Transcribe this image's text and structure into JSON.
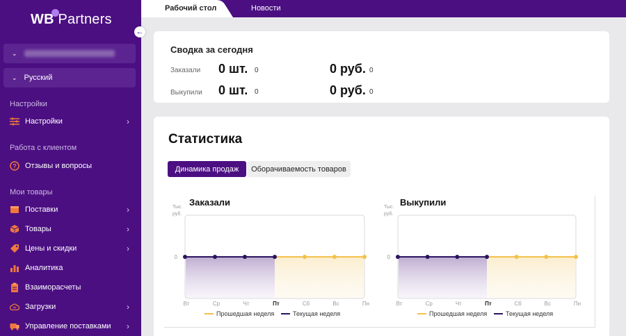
{
  "sidebar": {
    "logo": {
      "brand": "WB",
      "product": "Partners"
    },
    "language": "Русский",
    "sections": [
      "Настройки",
      "Работа с клиентом",
      "Мои товары"
    ],
    "items": [
      {
        "label": "Настройки",
        "icon": "sliders-icon"
      },
      {
        "label": "Отзывы и вопросы",
        "icon": "question-circle-icon"
      },
      {
        "label": "Поставки",
        "icon": "box-icon"
      },
      {
        "label": "Товары",
        "icon": "cube-icon"
      },
      {
        "label": "Цены и скидки",
        "icon": "tag-icon"
      },
      {
        "label": "Аналитика",
        "icon": "bar-chart-icon"
      },
      {
        "label": "Взаиморасчеты",
        "icon": "clipboard-icon"
      },
      {
        "label": "Загрузки",
        "icon": "cloud-upload-icon"
      },
      {
        "label": "Управление поставками",
        "icon": "truck-icon"
      }
    ]
  },
  "tabs": {
    "desktop": "Рабочий стол",
    "news": "Новости"
  },
  "summary": {
    "title": "Сводка за сегодня",
    "rows": [
      {
        "label": "Заказали",
        "qty": "0 шт.",
        "qty_small": "0",
        "sum": "0 руб.",
        "sum_small": "0"
      },
      {
        "label": "Выкупили",
        "qty": "0 шт.",
        "qty_small": "0",
        "sum": "0 руб.",
        "sum_small": "0"
      }
    ]
  },
  "statistics": {
    "title": "Статистика",
    "tab_dynamics": "Динамика продаж",
    "tab_turnover": "Оборачиваемость товаров"
  },
  "colors": {
    "brand": "#4b0f82",
    "prev_week": "#f5c04a",
    "curr_week": "#2b145e"
  },
  "chart_data": [
    {
      "type": "line",
      "title": "Заказали",
      "ylabel": "Тыс. руб.",
      "y_ticks": [
        "0"
      ],
      "categories": [
        "Вт",
        "Ср",
        "Чт",
        "Пт",
        "Сб",
        "Вс",
        "Пн"
      ],
      "highlight_category": "Пт",
      "series": [
        {
          "name": "Прошедшая неделя",
          "values": [
            0,
            0,
            0,
            0,
            0,
            0,
            0
          ]
        },
        {
          "name": "Текущая неделя",
          "values": [
            0,
            0,
            0,
            0
          ]
        }
      ],
      "legend": [
        "Прошедшая неделя",
        "Текущая неделя"
      ]
    },
    {
      "type": "line",
      "title": "Выкупили",
      "ylabel": "Тыс. руб.",
      "y_ticks": [
        "0"
      ],
      "categories": [
        "Вт",
        "Ср",
        "Чт",
        "Пт",
        "Сб",
        "Вс",
        "Пн"
      ],
      "highlight_category": "Пт",
      "series": [
        {
          "name": "Прошедшая неделя",
          "values": [
            0,
            0,
            0,
            0,
            0,
            0,
            0
          ]
        },
        {
          "name": "Текущая неделя",
          "values": [
            0,
            0,
            0,
            0
          ]
        }
      ],
      "legend": [
        "Прошедшая неделя",
        "Текущая неделя"
      ]
    }
  ]
}
